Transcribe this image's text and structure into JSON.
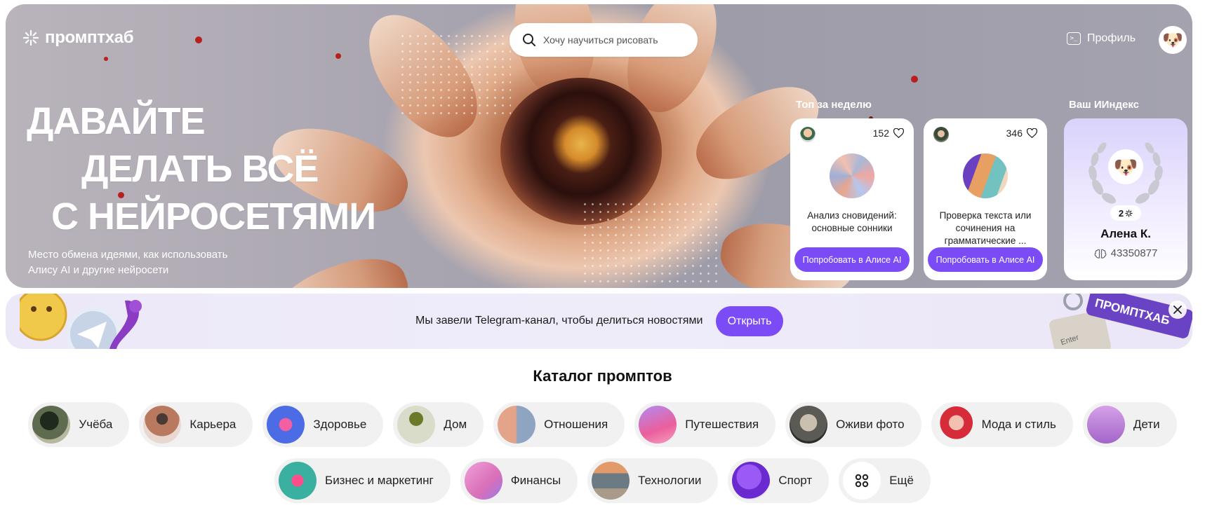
{
  "header": {
    "logo_text": "промптхаб",
    "search_placeholder": "Хочу научиться рисовать",
    "profile_label": "Профиль"
  },
  "hero": {
    "headline_line1": "ДАВАЙТЕ",
    "headline_line2": "ДЕЛАТЬ ВСЁ",
    "headline_line3": "С НЕЙРОСЕТЯМИ",
    "subtitle": "Место обмена идеями, как использовать Алису AI и другие нейросети"
  },
  "top_week": {
    "title": "Топ за неделю",
    "cards": [
      {
        "likes": "152",
        "title": "Анализ сновидений: основные сонники",
        "button": "Попробовать в Алисе AI"
      },
      {
        "likes": "346",
        "title": "Проверка текста или сочинения на грамматические ...",
        "button": "Попробовать в Алисе AI"
      }
    ]
  },
  "ai_index": {
    "title": "Ваш ИИндекс",
    "rank": "2",
    "name": "Алена К.",
    "score": "43350877"
  },
  "banner": {
    "text": "Мы завели Telegram-канал, чтобы делиться новостями",
    "button": "Открыть",
    "keychain_text": "ПРОМПТХАБ",
    "keycap_text": "Enter"
  },
  "catalog": {
    "title": "Каталог промптов",
    "row1": [
      {
        "label": "Учёба",
        "icon": "study-icon",
        "color": "#3b4a35"
      },
      {
        "label": "Карьера",
        "icon": "career-icon",
        "color": "#9a6a55"
      },
      {
        "label": "Здоровье",
        "icon": "heart-icon",
        "color": "#5a6ee0"
      },
      {
        "label": "Дом",
        "icon": "stool-icon",
        "color": "#7a8a4a"
      },
      {
        "label": "Отношения",
        "icon": "couple-icon",
        "color": "#c78772"
      },
      {
        "label": "Путешествия",
        "icon": "airplane-icon",
        "color": "#8b5cf6"
      },
      {
        "label": "Оживи фото",
        "icon": "cat-photo-icon",
        "color": "#6b6b6b"
      },
      {
        "label": "Мода и стиль",
        "icon": "fashion-icon",
        "color": "#d23a3a"
      },
      {
        "label": "Дети",
        "icon": "family-icon",
        "color": "#b37ad0"
      }
    ],
    "row2": [
      {
        "label": "Бизнес и маркетинг",
        "icon": "business-icon",
        "color": "#2f9c8a"
      },
      {
        "label": "Финансы",
        "icon": "piggy-bank-icon",
        "color": "#e276b8"
      },
      {
        "label": "Технологии",
        "icon": "tech-icon",
        "color": "#8a7a6a"
      },
      {
        "label": "Спорт",
        "icon": "ball-icon",
        "color": "#7b3ce0"
      },
      {
        "label": "Ещё",
        "icon": "grid-icon",
        "color": "#ffffff"
      }
    ]
  },
  "colors": {
    "accent": "#7b4cf6",
    "chip_bg": "#f1f1f2",
    "banner_bg": "#eeebf9"
  }
}
